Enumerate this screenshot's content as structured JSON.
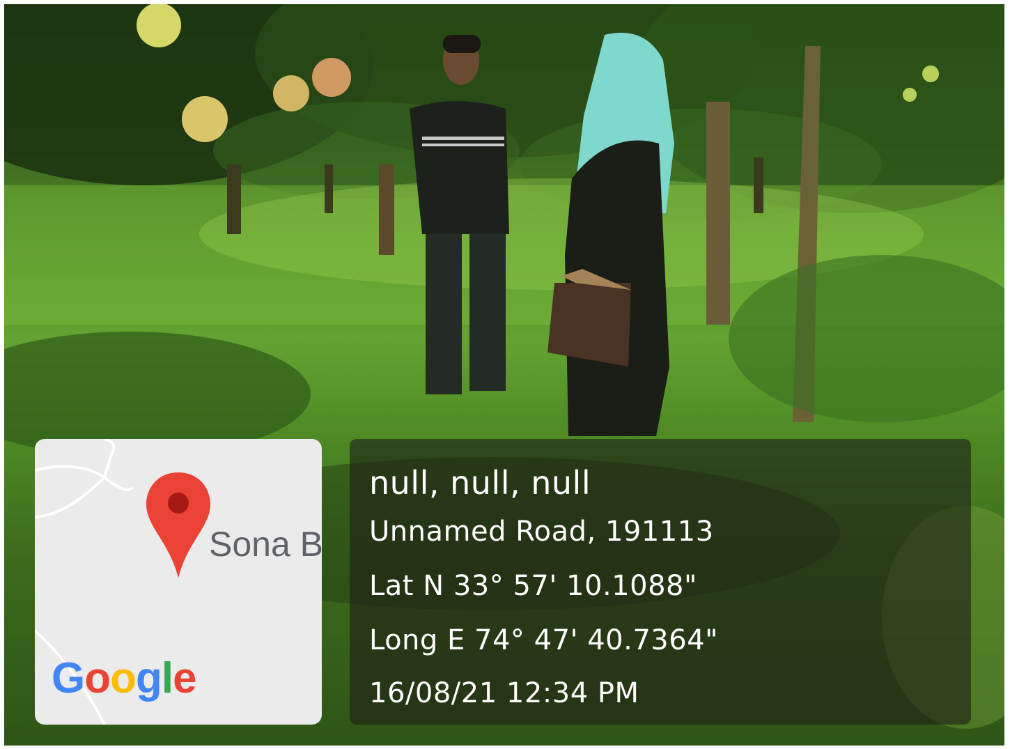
{
  "map": {
    "place_label": "Sona B",
    "logo": "Google",
    "logo_letters": [
      {
        "ch": "G",
        "color": "#4285F4"
      },
      {
        "ch": "o",
        "color": "#EA4335"
      },
      {
        "ch": "o",
        "color": "#FBBC05"
      },
      {
        "ch": "g",
        "color": "#4285F4"
      },
      {
        "ch": "l",
        "color": "#34A853"
      },
      {
        "ch": "e",
        "color": "#EA4335"
      }
    ],
    "pin_icon": "map-pin-icon",
    "pin_color": "#EA4335"
  },
  "info": {
    "lines": [
      "null, null, null",
      "Unnamed Road, 191113",
      "Lat N 33° 57' 10.1088\"",
      "Long E 74° 47' 40.7364\"",
      "16/08/21 12:34 PM"
    ]
  }
}
